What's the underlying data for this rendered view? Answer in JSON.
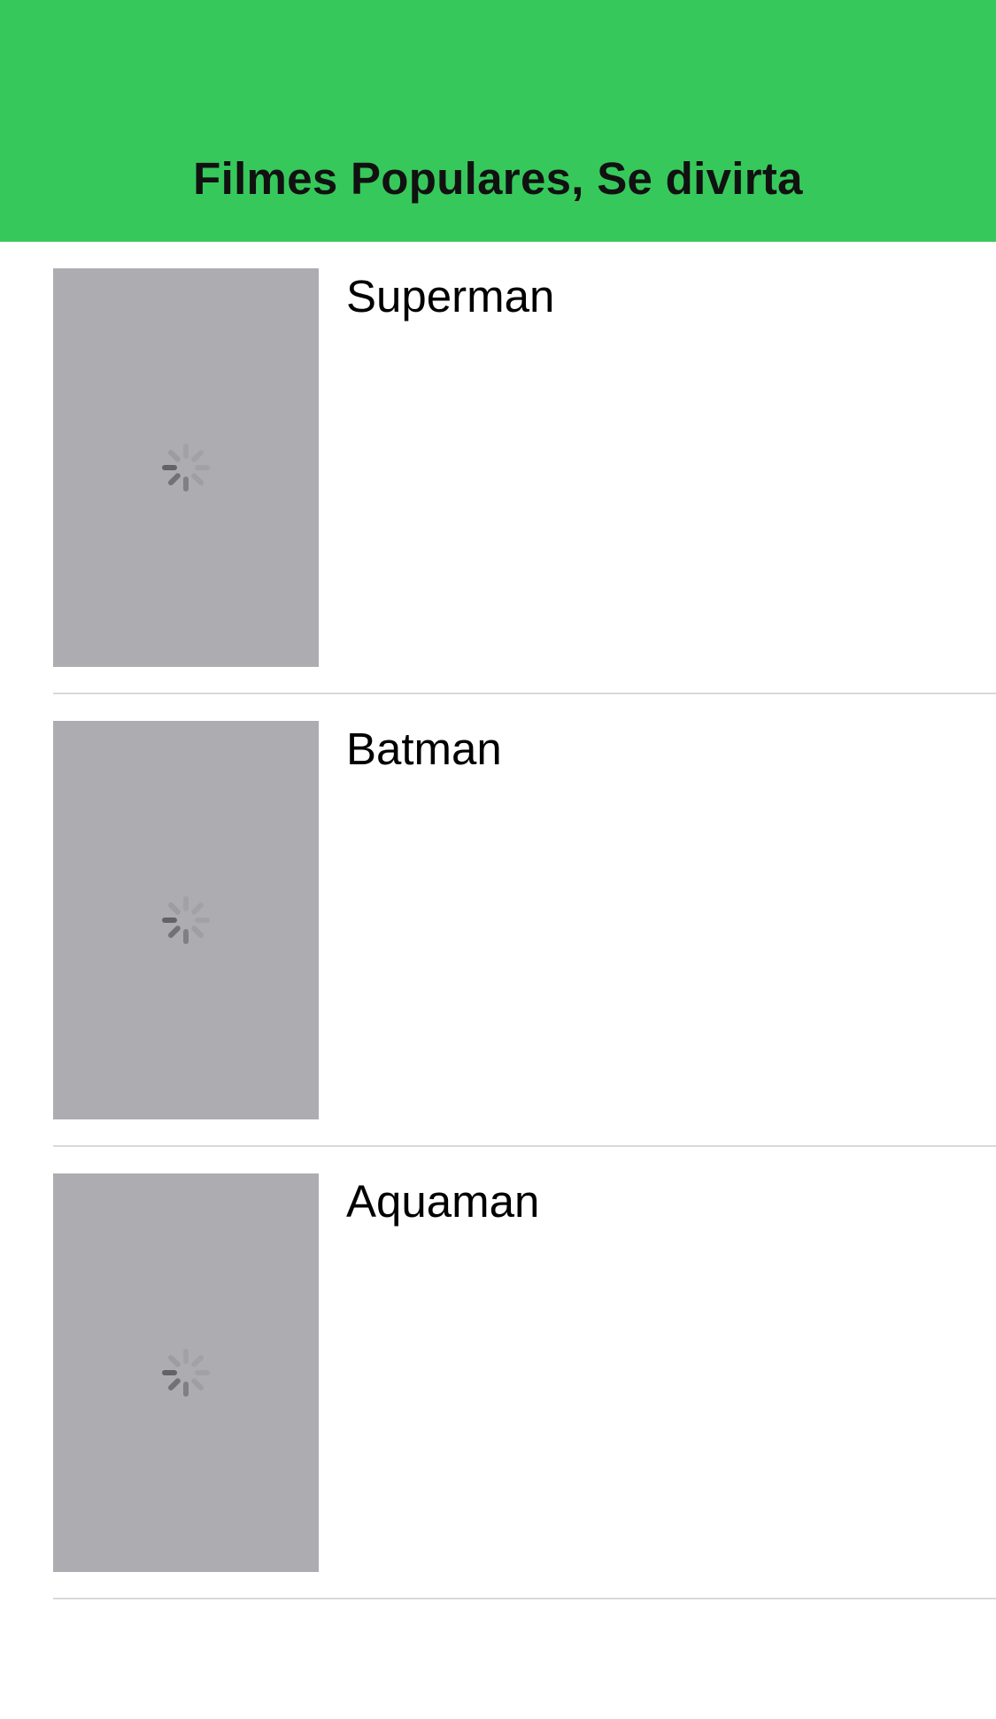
{
  "header": {
    "title": "Filmes Populares, Se divirta",
    "background_color": "#37c85b"
  },
  "movies": [
    {
      "title": "Superman",
      "poster_icon": "loading-spinner-icon"
    },
    {
      "title": "Batman",
      "poster_icon": "loading-spinner-icon"
    },
    {
      "title": "Aquaman",
      "poster_icon": "loading-spinner-icon"
    }
  ],
  "colors": {
    "poster_placeholder": "#adadb1",
    "separator": "#d9d9dc"
  }
}
